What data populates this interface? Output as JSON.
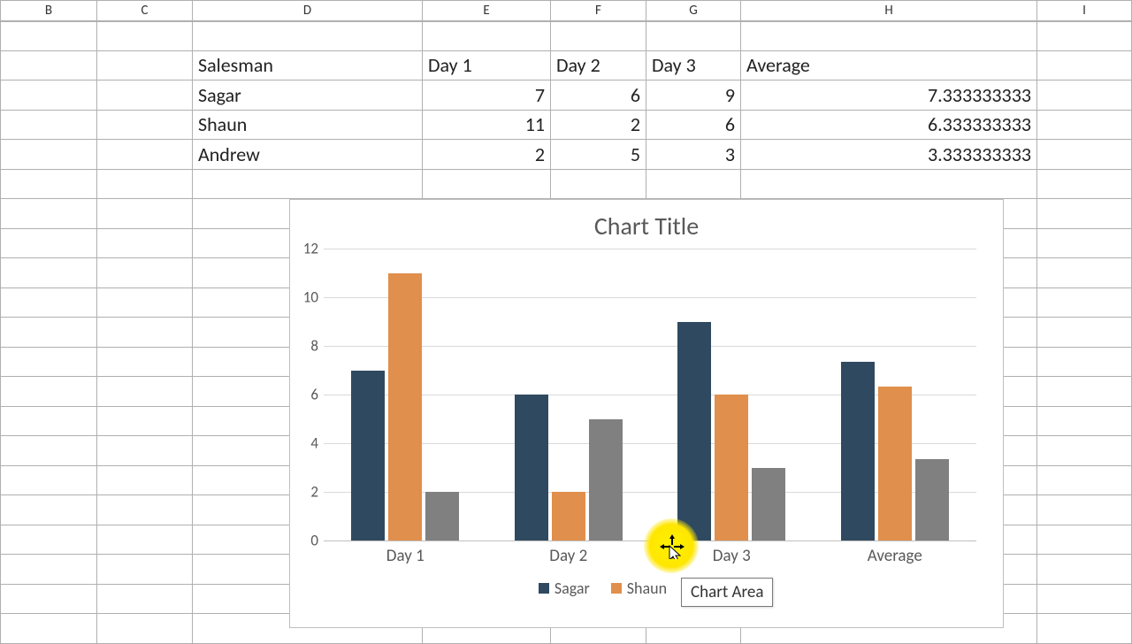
{
  "columns": [
    "B",
    "C",
    "D",
    "E",
    "F",
    "G",
    "H",
    "I"
  ],
  "table": {
    "headers": {
      "salesman": "Salesman",
      "d1": "Day 1",
      "d2": "Day 2",
      "d3": "Day 3",
      "avg": "Average"
    },
    "rows": [
      {
        "name": "Sagar",
        "d1": "7",
        "d2": "6",
        "d3": "9",
        "avg": "7.333333333"
      },
      {
        "name": "Shaun",
        "d1": "11",
        "d2": "2",
        "d3": "6",
        "avg": "6.333333333"
      },
      {
        "name": "Andrew",
        "d1": "2",
        "d2": "5",
        "d3": "3",
        "avg": "3.333333333"
      }
    ]
  },
  "chart_data": {
    "type": "bar",
    "title": "Chart Title",
    "categories": [
      "Day 1",
      "Day 2",
      "Day 3",
      "Average"
    ],
    "series": [
      {
        "name": "Sagar",
        "values": [
          7,
          6,
          9,
          7.333333333
        ]
      },
      {
        "name": "Shaun",
        "values": [
          11,
          2,
          6,
          6.333333333
        ]
      },
      {
        "name": "Andrew",
        "values": [
          2,
          5,
          3,
          3.333333333
        ]
      }
    ],
    "yticks": [
      0,
      2,
      4,
      6,
      8,
      10,
      12
    ],
    "ylim": [
      0,
      12
    ],
    "xlabel": "",
    "ylabel": "",
    "legend_position": "bottom",
    "colors": {
      "Sagar": "#2f4a60",
      "Shaun": "#e08f4c",
      "Andrew": "#808080"
    }
  },
  "tooltip": "Chart Area"
}
